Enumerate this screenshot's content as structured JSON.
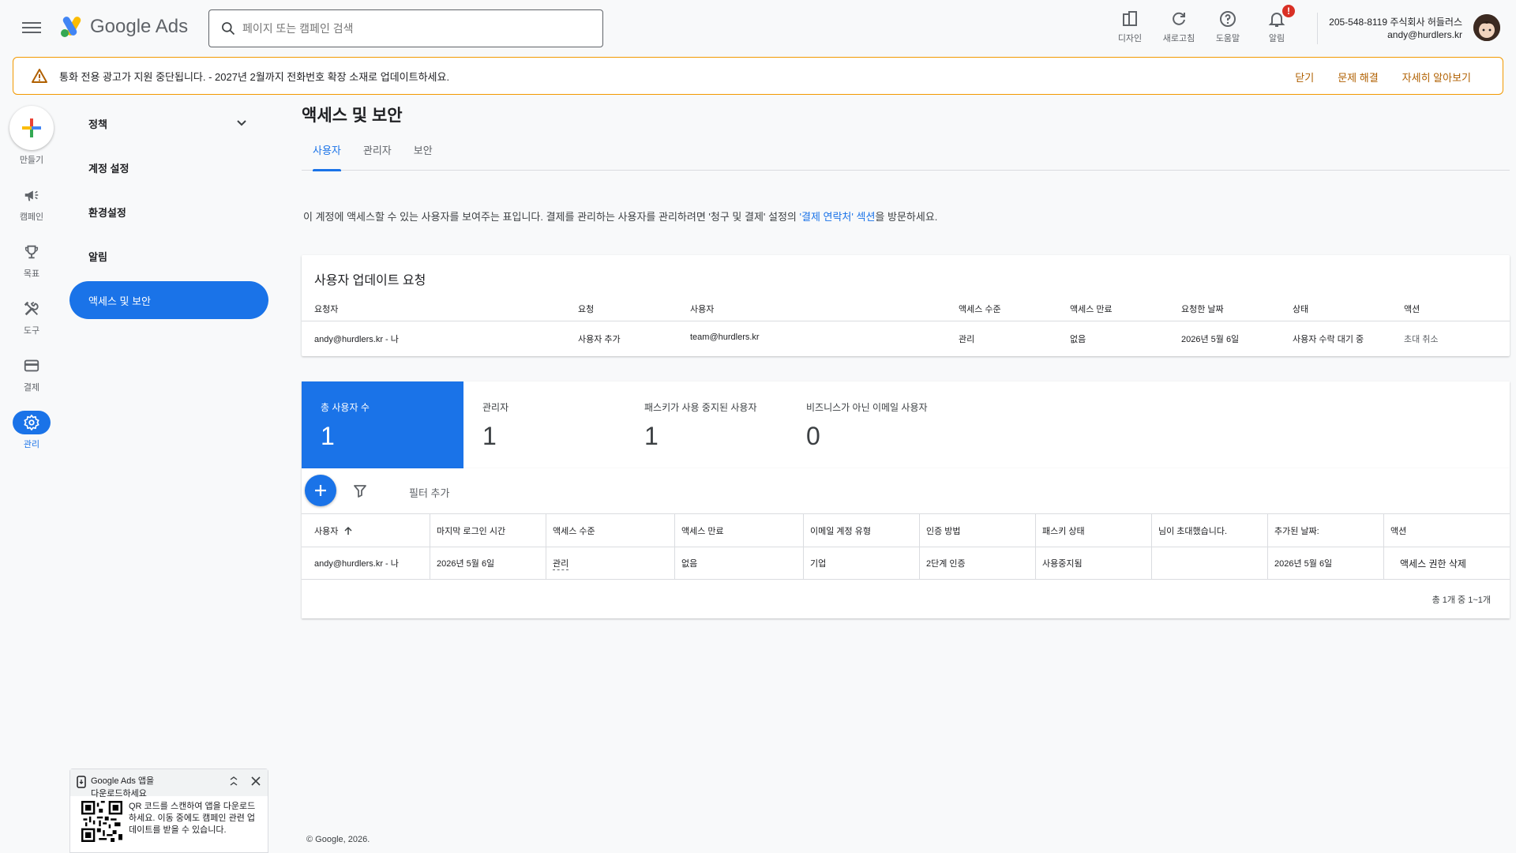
{
  "header": {
    "product": "Google Ads",
    "search_placeholder": "페이지 또는 캠페인 검색",
    "actions": [
      {
        "label": "디자인",
        "icon": "design-icon"
      },
      {
        "label": "새로고침",
        "icon": "refresh-icon"
      },
      {
        "label": "도움말",
        "icon": "help-icon"
      },
      {
        "label": "알림",
        "icon": "bell-icon",
        "badge": "!"
      }
    ],
    "account_line1": "205-548-8119 주식회사 허들러스",
    "account_line2": "andy@hurdlers.kr"
  },
  "banner": {
    "text": "통화 전용 광고가 지원 중단됩니다. - 2027년 2월까지 전화번호 확장 소재로 업데이트하세요.",
    "links": [
      "닫기",
      "문제 해결",
      "자세히 알아보기"
    ]
  },
  "rail": [
    {
      "label": "만들기",
      "icon": "plus-icon"
    },
    {
      "label": "캠페인",
      "icon": "megaphone-icon"
    },
    {
      "label": "목표",
      "icon": "trophy-icon"
    },
    {
      "label": "도구",
      "icon": "tools-icon"
    },
    {
      "label": "결제",
      "icon": "credit-card-icon"
    },
    {
      "label": "관리",
      "icon": "gear-icon",
      "active": true
    }
  ],
  "nav": [
    {
      "label": "정책"
    },
    {
      "label": "계정 설정"
    },
    {
      "label": "환경설정"
    },
    {
      "label": "알림"
    },
    {
      "label": "액세스 및 보안",
      "active": true
    }
  ],
  "page": {
    "title": "액세스 및 보안",
    "tabs": [
      "사용자",
      "관리자",
      "보안"
    ],
    "description_before": "이 계정에 액세스할 수 있는 사용자를 보여주는 표입니다. 결제를 관리하는 사용자를 관리하려면 '청구 및 결제' 설정의 ",
    "description_link": "'결제 연락처' 섹션",
    "description_after": "을 방문하세요."
  },
  "requests": {
    "title": "사용자 업데이트 요청",
    "columns": [
      "요청자",
      "요청",
      "사용자",
      "액세스 수준",
      "액세스 만료",
      "요청한 날짜",
      "상태",
      "액션"
    ],
    "row": [
      "andy@hurdlers.kr - 나",
      "사용자 추가",
      "team@hurdlers.kr",
      "관리",
      "없음",
      "2026년 5월 6일",
      "사용자 수락 대기 중",
      "초대 취소"
    ]
  },
  "stats": [
    {
      "label": "총 사용자 수",
      "value": "1"
    },
    {
      "label": "관리자",
      "value": "1"
    },
    {
      "label": "패스키가 사용 중지된 사용자",
      "value": "1"
    },
    {
      "label": "비즈니스가 아닌 이메일 사용자",
      "value": "0"
    }
  ],
  "users": {
    "filter_label": "필터 추가",
    "columns": [
      "사용자",
      "마지막 로그인 시간",
      "액세스 수준",
      "액세스 만료",
      "이메일 계정 유형",
      "인증 방법",
      "패스키 상태",
      "님이 초대했습니다.",
      "추가된 날짜:",
      "액션"
    ],
    "row": [
      "andy@hurdlers.kr - 나",
      "2026년 5월 6일",
      "관리",
      "없음",
      "기업",
      "2단계 인증",
      "사용중지됨",
      "",
      "2026년 5월 6일",
      "액세스 권한 삭제"
    ],
    "pagination": "총 1개 중 1~1개"
  },
  "footer": "© Google, 2026.",
  "promo": {
    "title_line1": "Google Ads 앱을",
    "title_line2": "다운로드하세요",
    "text": "QR 코드를 스캔하여 앱을 다운로드하세요. 이동 중에도 캠페인 관련 업데이트를 받을 수 있습니다."
  },
  "colors": {
    "accent": "#1a73e8",
    "warning": "#f29900",
    "link_warning": "#b06000"
  }
}
